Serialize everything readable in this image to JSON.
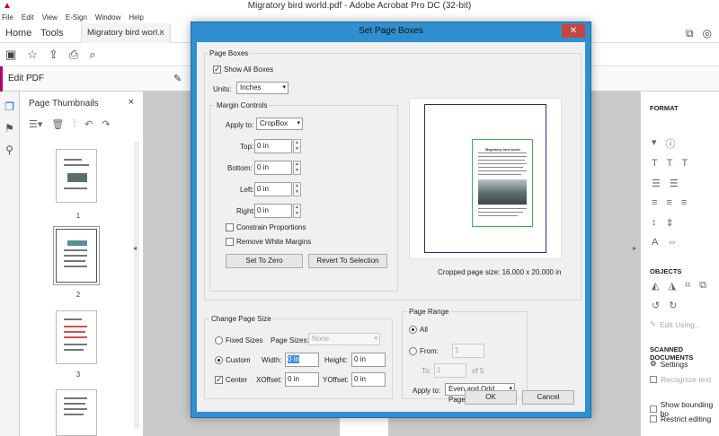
{
  "window": {
    "title": "Migratory bird world.pdf - Adobe Acrobat Pro DC (32-bit)",
    "buttons": [
      "—",
      "☐",
      "✕"
    ]
  },
  "menu": [
    "File",
    "Edit",
    "View",
    "E-Sign",
    "Window",
    "Help"
  ],
  "tabs": {
    "home": "Home",
    "tools": "Tools",
    "doc": "Migratory bird worl...",
    "doc_close": "×"
  },
  "editbar": {
    "label": "Edit PDF",
    "tool": "Edit",
    "close": "×"
  },
  "thumbnails": {
    "title": "Page Thumbnails",
    "close": "×",
    "pages": [
      "1",
      "2",
      "3"
    ]
  },
  "format_panel": {
    "format": "FORMAT",
    "objects": "OBJECTS",
    "edit_using": "Edit Using...",
    "scanned_documents": "SCANNED DOCUMENTS",
    "settings": "Settings",
    "recognize_text": "Recognize text",
    "show_bounding": "Show bounding bo",
    "restrict_editing": "Restrict editing"
  },
  "dialog": {
    "title": "Set Page Boxes",
    "close": "✕",
    "page_boxes": {
      "group_label": "Page Boxes",
      "show_all_boxes": "Show All Boxes",
      "show_all_boxes_checked": true,
      "units_label": "Units:",
      "units_value": "Inches"
    },
    "margin_controls": {
      "group_label": "Margin Controls",
      "apply_to_label": "Apply to:",
      "apply_to_value": "CropBox",
      "top_label": "Top:",
      "top_value": "0 in",
      "bottom_label": "Bottom:",
      "bottom_value": "0 in",
      "left_label": "Left:",
      "left_value": "0 in",
      "right_label": "Right:",
      "right_value": "0 in",
      "constrain_proportions": "Constrain Proportions",
      "remove_white_margins": "Remove White Margins",
      "set_to_zero": "Set To Zero",
      "revert_to_selection": "Revert To Selection"
    },
    "preview": {
      "doc_title": "Migratory bird world",
      "cropped_size": "Cropped page size: 16.000 x 20.000 in"
    },
    "change_page_size": {
      "group_label": "Change Page Size",
      "fixed_sizes": "Fixed Sizes",
      "page_sizes_label": "Page Sizes:",
      "page_sizes_value": "None",
      "custom": "Custom",
      "custom_selected": true,
      "width_label": "Width:",
      "width_value": "0 in",
      "height_label": "Height:",
      "height_value": "0 in",
      "center": "Center",
      "center_checked": true,
      "xoffset_label": "XOffset:",
      "xoffset_value": "0 in",
      "yoffset_label": "YOffset:",
      "yoffset_value": "0 in"
    },
    "page_range": {
      "group_label": "Page Range",
      "all": "All",
      "all_selected": true,
      "from": "From:",
      "from_value": "1",
      "to": "To:",
      "to_value": "1",
      "of_label": "of 5",
      "apply_to_label": "Apply to:",
      "apply_to_value": "Even and Odd Pages"
    },
    "ok": "OK",
    "cancel": "Cancel"
  }
}
